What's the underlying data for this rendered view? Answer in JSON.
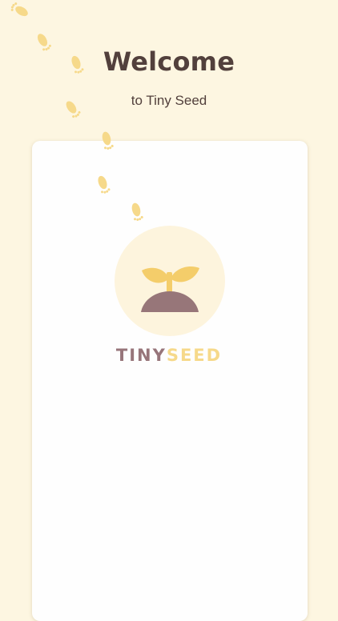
{
  "header": {
    "title": "Welcome",
    "subtitle": "to Tiny Seed"
  },
  "logo": {
    "brand_part1": "TINY",
    "brand_part2": "SEED",
    "icon": "sprout-icon"
  },
  "colors": {
    "background": "#fdf6e1",
    "card": "#fefefe",
    "title_text": "#52403c",
    "brand_primary": "#97757a",
    "brand_secondary": "#f6d98a",
    "leaf": "#f4cd6a",
    "soil": "#977679",
    "footprint": "#f6d98a"
  }
}
